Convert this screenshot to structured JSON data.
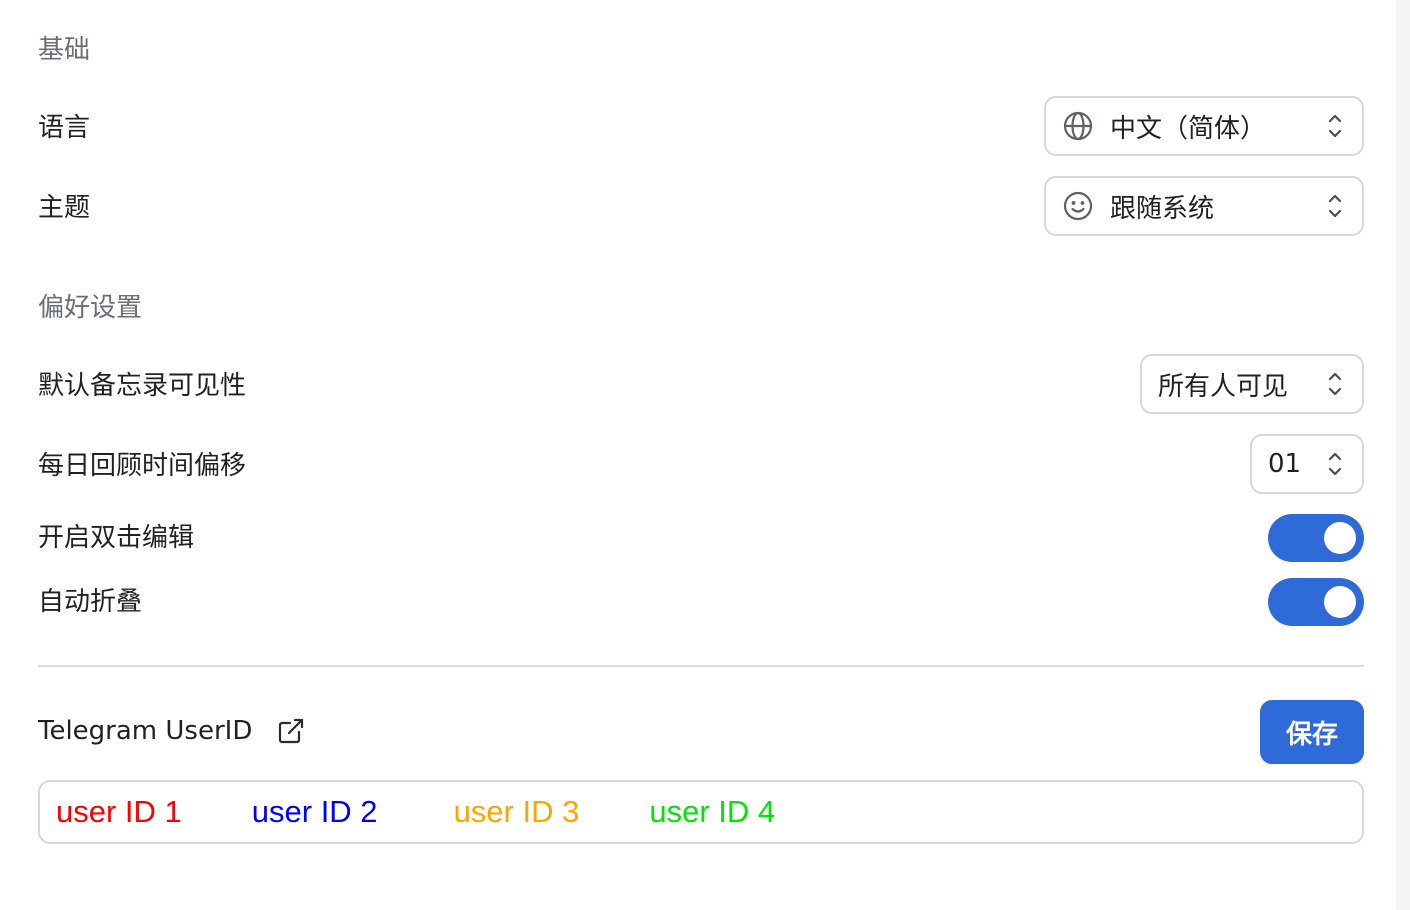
{
  "sections": {
    "basic_title": "基础",
    "preferences_title": "偏好设置"
  },
  "language": {
    "label": "语言",
    "value": "中文（简体）",
    "icon": "globe-icon"
  },
  "theme": {
    "label": "主题",
    "value": "跟随系统",
    "icon": "smiley-icon"
  },
  "memo_visibility": {
    "label": "默认备忘录可见性",
    "value": "所有人可见"
  },
  "daily_review_offset": {
    "label": "每日回顾时间偏移",
    "value": "01"
  },
  "double_click_edit": {
    "label": "开启双击编辑",
    "enabled": true
  },
  "auto_collapse": {
    "label": "自动折叠",
    "enabled": true
  },
  "telegram": {
    "label": "Telegram UserID",
    "link_icon": "external-link-icon",
    "save_label": "保存",
    "user_ids": [
      {
        "text": "user ID 1",
        "color": "#ff0000"
      },
      {
        "text": "user ID 2",
        "color": "#0000ff"
      },
      {
        "text": "user ID 3",
        "color": "#ffa500"
      },
      {
        "text": "user ID 4",
        "color": "#00e600"
      }
    ]
  },
  "colors": {
    "accent": "#2f6ad9",
    "section_title": "#6b6e76",
    "border": "#d6d8dc"
  }
}
